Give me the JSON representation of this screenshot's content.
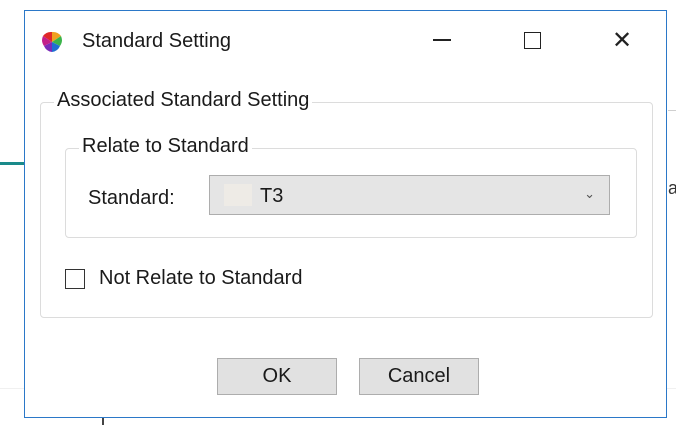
{
  "window": {
    "title": "Standard Setting",
    "icon": "color-wheel-icon",
    "accent": "#2b78c8"
  },
  "titlebar": {
    "minimize_icon": "minimize-icon",
    "maximize_icon": "maximize-icon",
    "close_icon": "close-icon",
    "close_glyph": "✕"
  },
  "associated_group": {
    "legend": "Associated Standard Setting",
    "relate_group": {
      "legend": "Relate to Standard",
      "standard_label": "Standard:",
      "standard_value": "T3",
      "dropdown_icon": "chevron-down-icon",
      "dropdown_glyph": "⌄"
    },
    "not_relate": {
      "label": "Not Relate to Standard",
      "checked": false
    }
  },
  "buttons": {
    "ok": "OK",
    "cancel": "Cancel"
  }
}
